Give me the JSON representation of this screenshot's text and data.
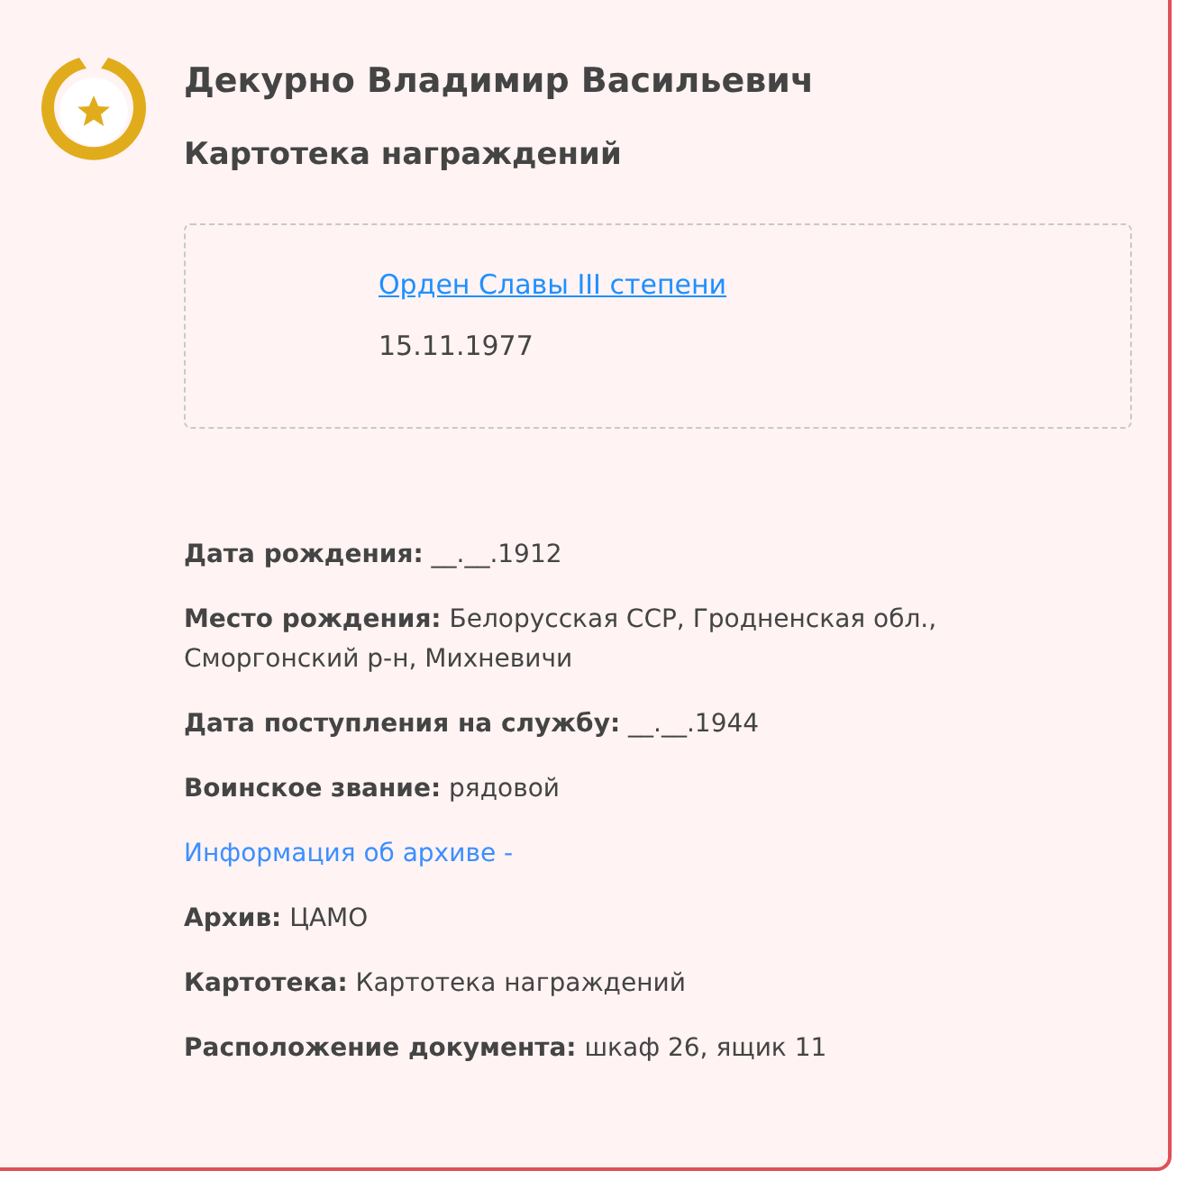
{
  "person": {
    "name": "Декурно Владимир Васильевич",
    "subtitle": "Картотека награждений"
  },
  "award": {
    "title": "Орден Славы III степени",
    "date": "15.11.1977"
  },
  "facts": [
    {
      "kind": "field",
      "label": "Дата рождения:",
      "value": "__.__.1912"
    },
    {
      "kind": "field",
      "label": "Место рождения:",
      "value": "Белорусская ССР, Гродненская обл., Сморгонский р-н, Михневичи"
    },
    {
      "kind": "field",
      "label": "Дата поступления на службу:",
      "value": "__.__.1944"
    },
    {
      "kind": "field",
      "label": "Воинское звание:",
      "value": "рядовой"
    },
    {
      "kind": "link",
      "text": "Информация об архиве -"
    },
    {
      "kind": "field",
      "label": "Архив:",
      "value": "ЦАМО"
    },
    {
      "kind": "field",
      "label": "Картотека:",
      "value": "Картотека награждений"
    },
    {
      "kind": "field",
      "label": "Расположение документа:",
      "value": "шкаф 26, ящик 11"
    }
  ]
}
